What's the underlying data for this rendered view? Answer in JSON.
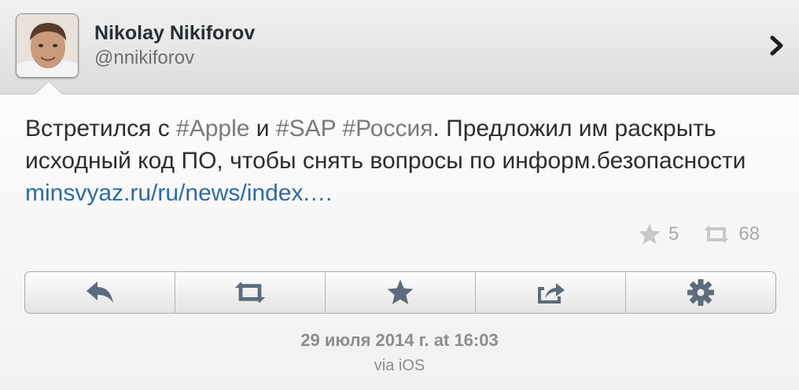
{
  "user": {
    "name": "Nikolay Nikiforov",
    "handle": "@nnikiforov"
  },
  "tweet": {
    "parts": {
      "t1": "Встретился с ",
      "h1": "#Apple",
      "t2": " и ",
      "h2": "#SAP",
      "t3": " ",
      "h3": "#Россия",
      "t4": ". Предложил им раскрыть исходный код ПО, чтобы снять вопросы по информ.безопасности ",
      "link": "minsvyaz.ru/ru/news/index.…"
    }
  },
  "stats": {
    "favorites": "5",
    "retweets": "68"
  },
  "actions": [
    {
      "name": "reply",
      "icon": "reply-icon"
    },
    {
      "name": "retweet",
      "icon": "retweet-icon"
    },
    {
      "name": "favorite",
      "icon": "star-icon"
    },
    {
      "name": "share",
      "icon": "share-icon"
    },
    {
      "name": "settings",
      "icon": "gear-icon"
    }
  ],
  "meta": {
    "timestamp": "29 июля 2014 г. at 16:03",
    "via": "via iOS"
  },
  "colors": {
    "hashtag": "#7a7a7a",
    "link": "#2b6ba8",
    "icon": "#5c6c7c"
  }
}
